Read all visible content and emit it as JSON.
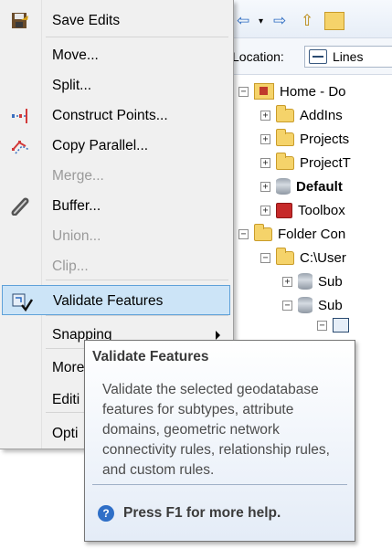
{
  "catalog": {
    "location_label": "Location:",
    "location_value": "Lines",
    "tree": [
      {
        "label": "Home - Do",
        "indent": 0,
        "expander": "−",
        "icon": "home-folder-icon",
        "bold": false
      },
      {
        "label": "AddIns",
        "indent": 1,
        "expander": "+",
        "icon": "folder-icon",
        "bold": false
      },
      {
        "label": "Projects",
        "indent": 1,
        "expander": "+",
        "icon": "folder-icon",
        "bold": false
      },
      {
        "label": "ProjectT",
        "indent": 1,
        "expander": "+",
        "icon": "folder-icon",
        "bold": false
      },
      {
        "label": "Default",
        "indent": 1,
        "expander": "+",
        "icon": "default-geodatabase-icon",
        "bold": true
      },
      {
        "label": "Toolbox",
        "indent": 1,
        "expander": "+",
        "icon": "toolbox-icon",
        "bold": false
      },
      {
        "label": "Folder Con",
        "indent": 0,
        "expander": "−",
        "icon": "folder-connections-icon",
        "bold": false
      },
      {
        "label": "C:\\User",
        "indent": 1,
        "expander": "−",
        "icon": "folder-connection-icon",
        "bold": false
      },
      {
        "label": "Sub",
        "indent": 2,
        "expander": "+",
        "icon": "geodatabase-icon",
        "bold": false
      },
      {
        "label": "Sub",
        "indent": 2,
        "expander": "−",
        "icon": "geodatabase-icon",
        "bold": false
      }
    ]
  },
  "menu": {
    "items": [
      {
        "label": "Save Edits",
        "icon": "save-edits-icon",
        "disabled": false
      },
      {
        "label": "Move...",
        "icon": "",
        "disabled": false
      },
      {
        "label": "Split...",
        "icon": "",
        "disabled": false
      },
      {
        "label": "Construct Points...",
        "icon": "construct-points-icon",
        "disabled": false
      },
      {
        "label": "Copy Parallel...",
        "icon": "copy-parallel-icon",
        "disabled": false
      },
      {
        "label": "Merge...",
        "icon": "",
        "disabled": true
      },
      {
        "label": "Buffer...",
        "icon": "buffer-icon",
        "disabled": false
      },
      {
        "label": "Union...",
        "icon": "",
        "disabled": true
      },
      {
        "label": "Clip...",
        "icon": "",
        "disabled": true
      },
      {
        "label": "Validate Features",
        "icon": "validate-features-icon",
        "disabled": false,
        "highlighted": true
      },
      {
        "label": "Snapping",
        "icon": "",
        "disabled": false,
        "submenu": true
      },
      {
        "label": "More",
        "icon": "",
        "disabled": false
      },
      {
        "label": "Editi",
        "icon": "",
        "disabled": false
      },
      {
        "label": "Opti",
        "icon": "",
        "disabled": false
      }
    ]
  },
  "tooltip": {
    "title": "Validate Features",
    "body": "Validate the selected geodatabase features for subtypes, attribute domains, geometric network connectivity rules, relationship rules, and custom rules.",
    "help": "Press F1 for more help."
  },
  "colors": {
    "highlight_bg": "#cce4f7",
    "highlight_border": "#5fa1d9",
    "help_icon": "#2f6fc7"
  }
}
